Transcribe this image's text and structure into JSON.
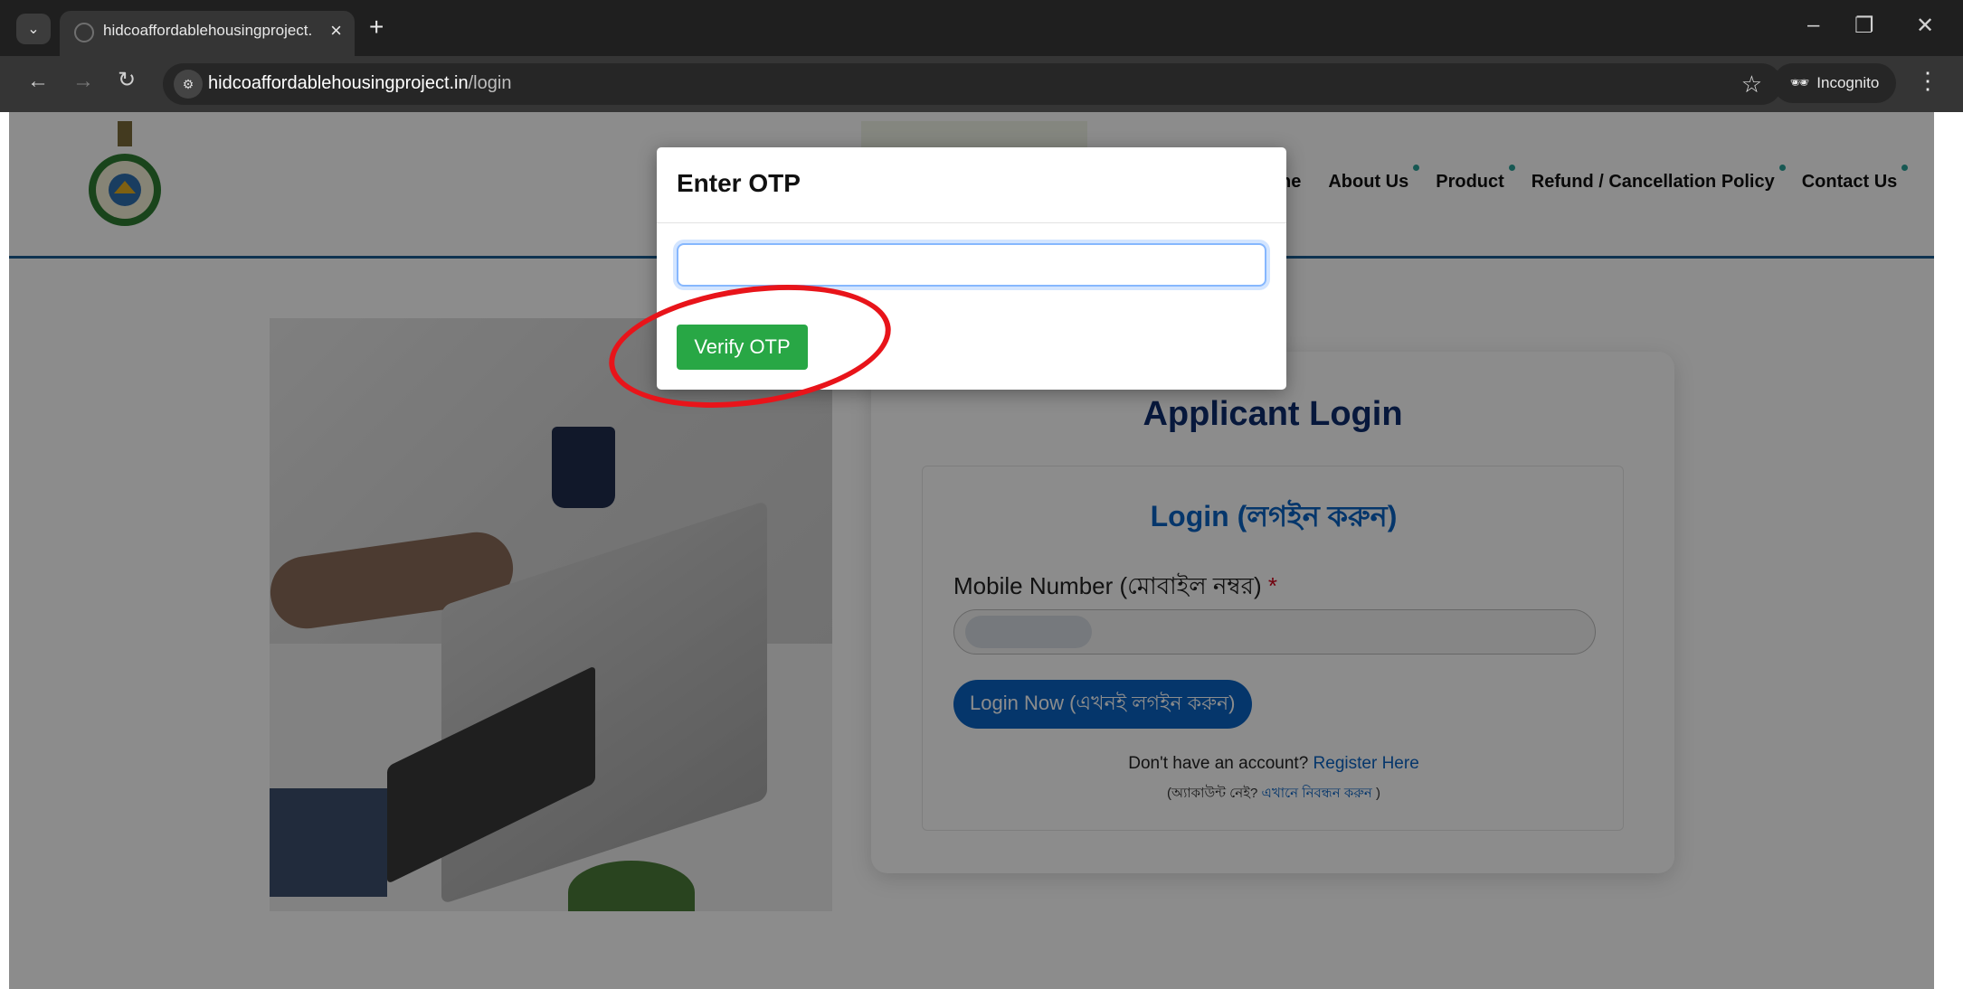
{
  "browser": {
    "tab_title": "hidcoaffordablehousingproject.",
    "url_host": "hidcoaffordablehousingproject.in",
    "url_path": "/login",
    "incognito_label": "Incognito"
  },
  "header": {
    "nav": [
      "ne",
      "About Us",
      "Product",
      "Refund / Cancellation Policy",
      "Contact Us"
    ]
  },
  "login": {
    "heading": "Applicant Login",
    "subheading": "Login (লগইন করুন)",
    "mobile_label": "Mobile Number (মোবাইল নম্বর)",
    "required_mark": "*",
    "login_button": "Login Now (এখনই লগইন করুন)",
    "register_prefix": "Don't have an account?",
    "register_link": "Register Here",
    "register_bn_prefix": "(অ্যাকাউন্ট নেই?",
    "register_bn_link": "এখানে নিবন্ধন করুন",
    "register_bn_suffix": ")"
  },
  "modal": {
    "title": "Enter OTP",
    "otp_value": "",
    "verify_button": "Verify OTP"
  },
  "colors": {
    "heading_navy": "#0d2c6e",
    "link_blue": "#0a63c4",
    "verify_green": "#28a745",
    "highlight_red": "#e8141a"
  }
}
